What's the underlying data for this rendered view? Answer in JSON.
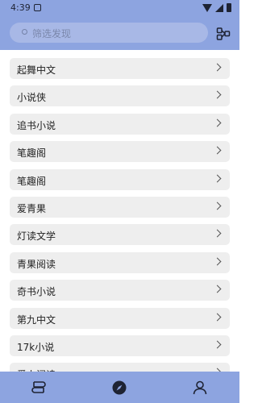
{
  "status_bar": {
    "time": "4:39"
  },
  "search": {
    "placeholder": "筛选发现"
  },
  "sources": [
    {
      "label": "起舞中文"
    },
    {
      "label": "小说侠"
    },
    {
      "label": "追书小说"
    },
    {
      "label": "笔趣阁"
    },
    {
      "label": "笔趣阁"
    },
    {
      "label": "爱青果"
    },
    {
      "label": "灯读文学"
    },
    {
      "label": "青果阅读"
    },
    {
      "label": "奇书小说"
    },
    {
      "label": "第九中文"
    },
    {
      "label": "17k小说"
    },
    {
      "label": "爱上阅读"
    }
  ],
  "colors": {
    "accent": "#8da4e0",
    "item_bg": "#eeeeee"
  },
  "icons": {
    "chevron": "chevron-right-icon",
    "nav": [
      "bookshelf-icon",
      "compass-icon",
      "person-icon"
    ]
  }
}
